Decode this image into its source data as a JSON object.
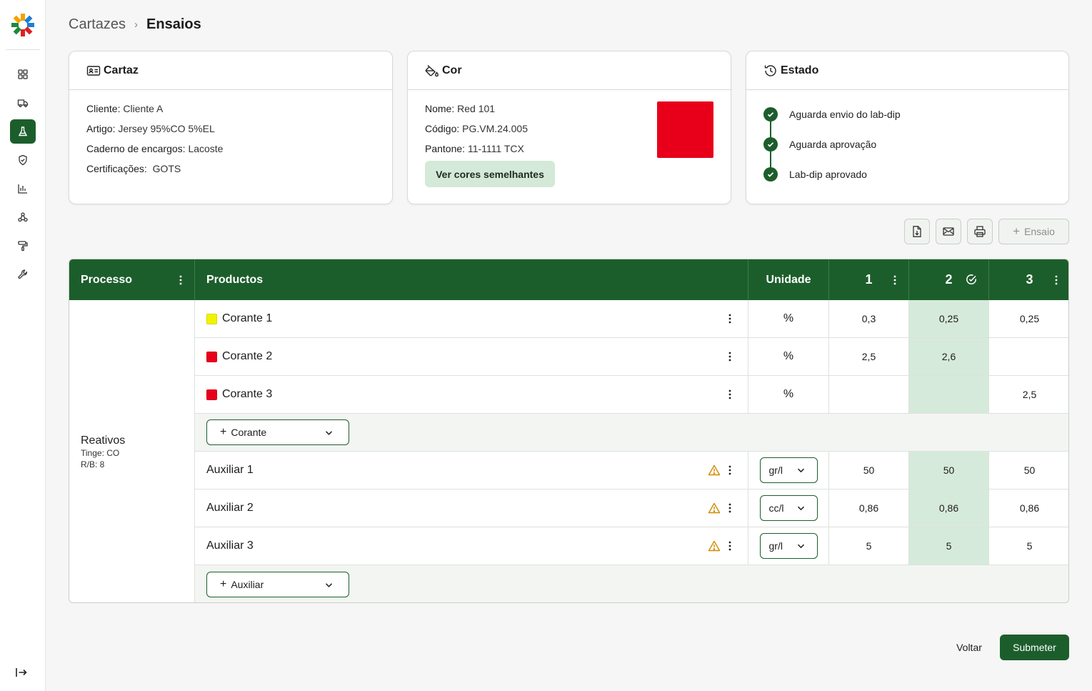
{
  "breadcrumb": {
    "parent": "Cartazes",
    "current": "Ensaios"
  },
  "sidebar": {
    "items": [
      {
        "icon": "grid-icon"
      },
      {
        "icon": "truck-icon"
      },
      {
        "icon": "flask-icon",
        "active": true
      },
      {
        "icon": "shield-check-icon"
      },
      {
        "icon": "bar-chart-icon"
      },
      {
        "icon": "molecule-icon"
      },
      {
        "icon": "paint-roller-icon"
      },
      {
        "icon": "wrench-icon"
      }
    ],
    "collapse_icon": "collapse-arrow-icon"
  },
  "cartaz": {
    "title": "Cartaz",
    "cliente_k": "Cliente:",
    "cliente_v": "Cliente A",
    "artigo_k": "Artigo:",
    "artigo_v": "Jersey 95%CO 5%EL",
    "caderno_k": "Caderno de encargos:",
    "caderno_v": "Lacoste",
    "cert_k": "Certificações:",
    "cert_v": "GOTS"
  },
  "cor": {
    "title": "Cor",
    "nome_k": "Nome:",
    "nome_v": "Red 101",
    "codigo_k": "Código:",
    "codigo_v": "PG.VM.24.005",
    "pantone_k": "Pantone:",
    "pantone_v": "11-1111 TCX",
    "button": "Ver cores semelhantes",
    "swatch_color": "#e8001a"
  },
  "estado": {
    "title": "Estado",
    "steps": [
      "Aguarda envio do lab-dip",
      "Aguarda aprovação",
      "Lab-dip aprovado"
    ]
  },
  "toolbar": {
    "ensaio_label": "Ensaio"
  },
  "table": {
    "headers": {
      "processo": "Processo",
      "productos": "Productos",
      "unidade": "Unidade",
      "t1": "1",
      "t2": "2",
      "t3": "3"
    },
    "process": {
      "name": "Reativos",
      "tinge": "Tinge: CO",
      "rb": "R/B: 8"
    },
    "corantes": [
      {
        "name": "Corante 1",
        "color": "#f2f200",
        "unit": "%",
        "v1": "0,3",
        "v2": "0,25",
        "v3": "0,25"
      },
      {
        "name": "Corante 2",
        "color": "#e8001a",
        "unit": "%",
        "v1": "2,5",
        "v2": "2,6",
        "v3": ""
      },
      {
        "name": "Corante 3",
        "color": "#e8001a",
        "unit": "%",
        "v1": "",
        "v2": "",
        "v3": "2,5"
      }
    ],
    "add_corante": "Corante",
    "auxiliares": [
      {
        "name": "Auxiliar 1",
        "unit": "gr/l",
        "v1": "50",
        "v2": "50",
        "v3": "50"
      },
      {
        "name": "Auxiliar 2",
        "unit": "cc/l",
        "v1": "0,86",
        "v2": "0,86",
        "v3": "0,86"
      },
      {
        "name": "Auxiliar 3",
        "unit": "gr/l",
        "v1": "5",
        "v2": "5",
        "v3": "5"
      }
    ],
    "add_auxiliar": "Auxiliar"
  },
  "footer": {
    "back": "Voltar",
    "submit": "Submeter"
  }
}
